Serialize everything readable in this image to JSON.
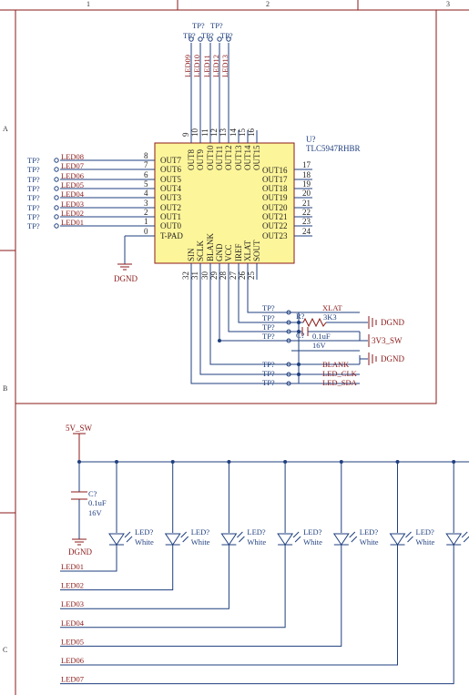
{
  "frame": {
    "columns": [
      "1",
      "2",
      "3"
    ],
    "rows": [
      "A",
      "B",
      "C"
    ]
  },
  "ic": {
    "designator": "U?",
    "part": "TLC5947RHBR",
    "left_pins": [
      {
        "name": "OUT7",
        "num": "8",
        "net": "LED08"
      },
      {
        "name": "OUT6",
        "num": "7",
        "net": "LED07"
      },
      {
        "name": "OUT5",
        "num": "6",
        "net": "LED06"
      },
      {
        "name": "OUT4",
        "num": "5",
        "net": "LED05"
      },
      {
        "name": "OUT3",
        "num": "4",
        "net": "LED04"
      },
      {
        "name": "OUT2",
        "num": "3",
        "net": "LED03"
      },
      {
        "name": "OUT1",
        "num": "2",
        "net": "LED02"
      },
      {
        "name": "OUT0",
        "num": "1",
        "net": "LED01"
      },
      {
        "name": "T-PAD",
        "num": "0",
        "net": ""
      }
    ],
    "right_pins": [
      {
        "name": "OUT16",
        "num": "17"
      },
      {
        "name": "OUT17",
        "num": "18"
      },
      {
        "name": "OUT18",
        "num": "19"
      },
      {
        "name": "OUT19",
        "num": "20"
      },
      {
        "name": "OUT20",
        "num": "21"
      },
      {
        "name": "OUT21",
        "num": "22"
      },
      {
        "name": "OUT22",
        "num": "23"
      },
      {
        "name": "OUT23",
        "num": "24"
      }
    ],
    "top_pins": [
      {
        "name": "OUT8",
        "num": "9",
        "net": "LED09"
      },
      {
        "name": "OUT9",
        "num": "10",
        "net": "LED10"
      },
      {
        "name": "OUT10",
        "num": "11",
        "net": "LED11"
      },
      {
        "name": "OUT11",
        "num": "12",
        "net": "LED12"
      },
      {
        "name": "OUT12",
        "num": "13",
        "net": "LED13"
      },
      {
        "name": "OUT13",
        "num": "14",
        "net": ""
      },
      {
        "name": "OUT14",
        "num": "15",
        "net": ""
      },
      {
        "name": "OUT15",
        "num": "16",
        "net": ""
      }
    ],
    "bottom_pins": [
      {
        "name": "SIN",
        "num": "32"
      },
      {
        "name": "SCLK",
        "num": "31"
      },
      {
        "name": "BLANK",
        "num": "30"
      },
      {
        "name": "GND",
        "num": "29"
      },
      {
        "name": "VCC",
        "num": "28"
      },
      {
        "name": "IREF",
        "num": "27"
      },
      {
        "name": "XLAT",
        "num": "26"
      },
      {
        "name": "SOUT",
        "num": "25"
      }
    ]
  },
  "testpoint_label": "TP?",
  "ground_label": "DGND",
  "resistor": {
    "designator": "R?",
    "value": "3K3"
  },
  "cap_top": {
    "designator": "C?",
    "value": "0.1uF",
    "voltage": "16V"
  },
  "cap_bottom": {
    "designator": "C?",
    "value": "0.1uF",
    "voltage": "16V"
  },
  "nets": {
    "xlat": "XLAT",
    "blank": "BLANK",
    "led_clk": "LED_CLK",
    "led_sda": "LED_SDA",
    "dgnd_port_1": "DGND",
    "dgnd_port_2": "DGND",
    "v3_sw": "3V3_SW",
    "v5_sw": "5V_SW"
  },
  "leds": [
    {
      "designator": "LED?",
      "color": "White",
      "net": "LED01"
    },
    {
      "designator": "LED?",
      "color": "White",
      "net": "LED02"
    },
    {
      "designator": "LED?",
      "color": "White",
      "net": "LED03"
    },
    {
      "designator": "LED?",
      "color": "White",
      "net": "LED04"
    },
    {
      "designator": "LED?",
      "color": "White",
      "net": "LED05"
    },
    {
      "designator": "LED?",
      "color": "White",
      "net": "LED06"
    },
    {
      "designator": "LED?",
      "color": "White",
      "net": "LED07"
    }
  ],
  "colors": {
    "wire": "#1f3f7f",
    "frame": "#8b1a1a",
    "ic_fill": "#fdf59a",
    "ic_stroke": "#8b1a1a"
  }
}
